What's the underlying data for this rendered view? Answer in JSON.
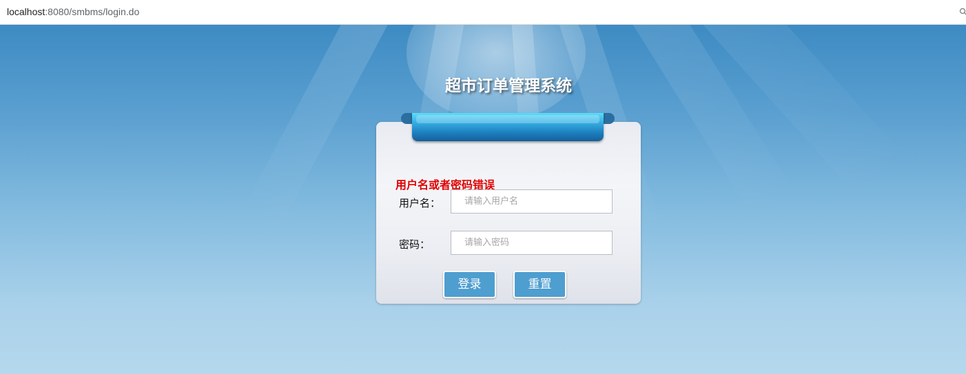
{
  "browser": {
    "url_host": "localhost",
    "url_rest": ":8080/smbms/login.do",
    "key_icon": "key-icon"
  },
  "page": {
    "title": "超市订单管理系统"
  },
  "login": {
    "error_message": "用户名或者密码错误",
    "username_label": "用户名：",
    "username_placeholder": "请输入用户名",
    "username_value": "",
    "password_label": "密码：",
    "password_placeholder": "请输入密码",
    "password_value": "",
    "login_button": "登录",
    "reset_button": "重置"
  },
  "colors": {
    "background_top": "#3d8bc3",
    "background_bottom": "#b5d8ec",
    "ribbon": "#1d7fbf",
    "error": "#e00000",
    "button": "#4e9ed0"
  }
}
